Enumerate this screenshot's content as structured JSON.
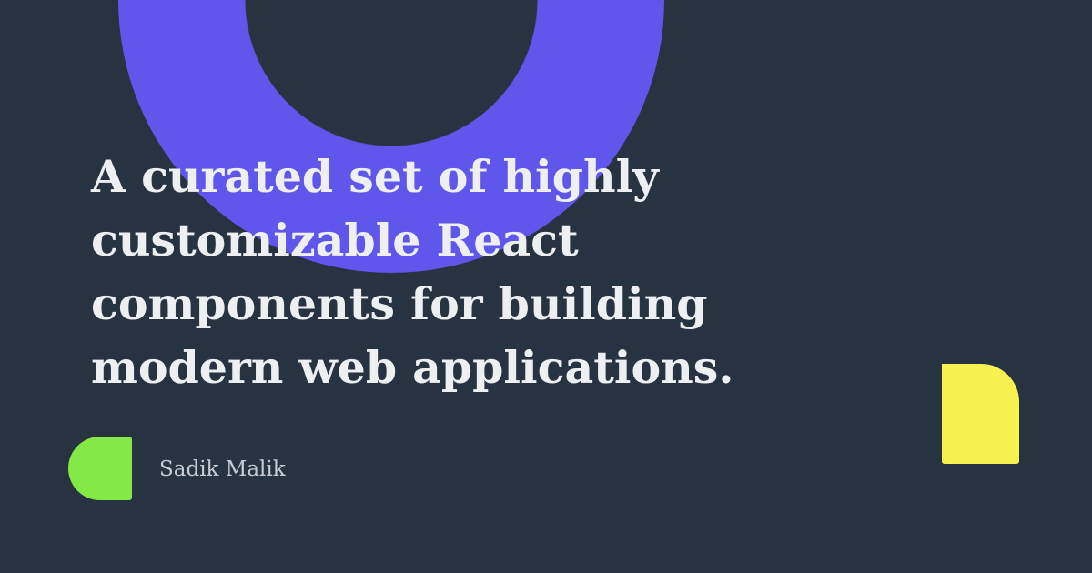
{
  "headline": {
    "lines": [
      "A curated set of highly",
      "customizable React",
      "components for building",
      "modern web applications."
    ]
  },
  "author": {
    "name": "Sadik Malik"
  },
  "colors": {
    "background": "#283341",
    "ring": "#5f56ec",
    "text": "#eeeff1",
    "author_text": "#c7ccd4",
    "yellow_shape": "#f8f14f",
    "green_shape": "#84e847"
  }
}
